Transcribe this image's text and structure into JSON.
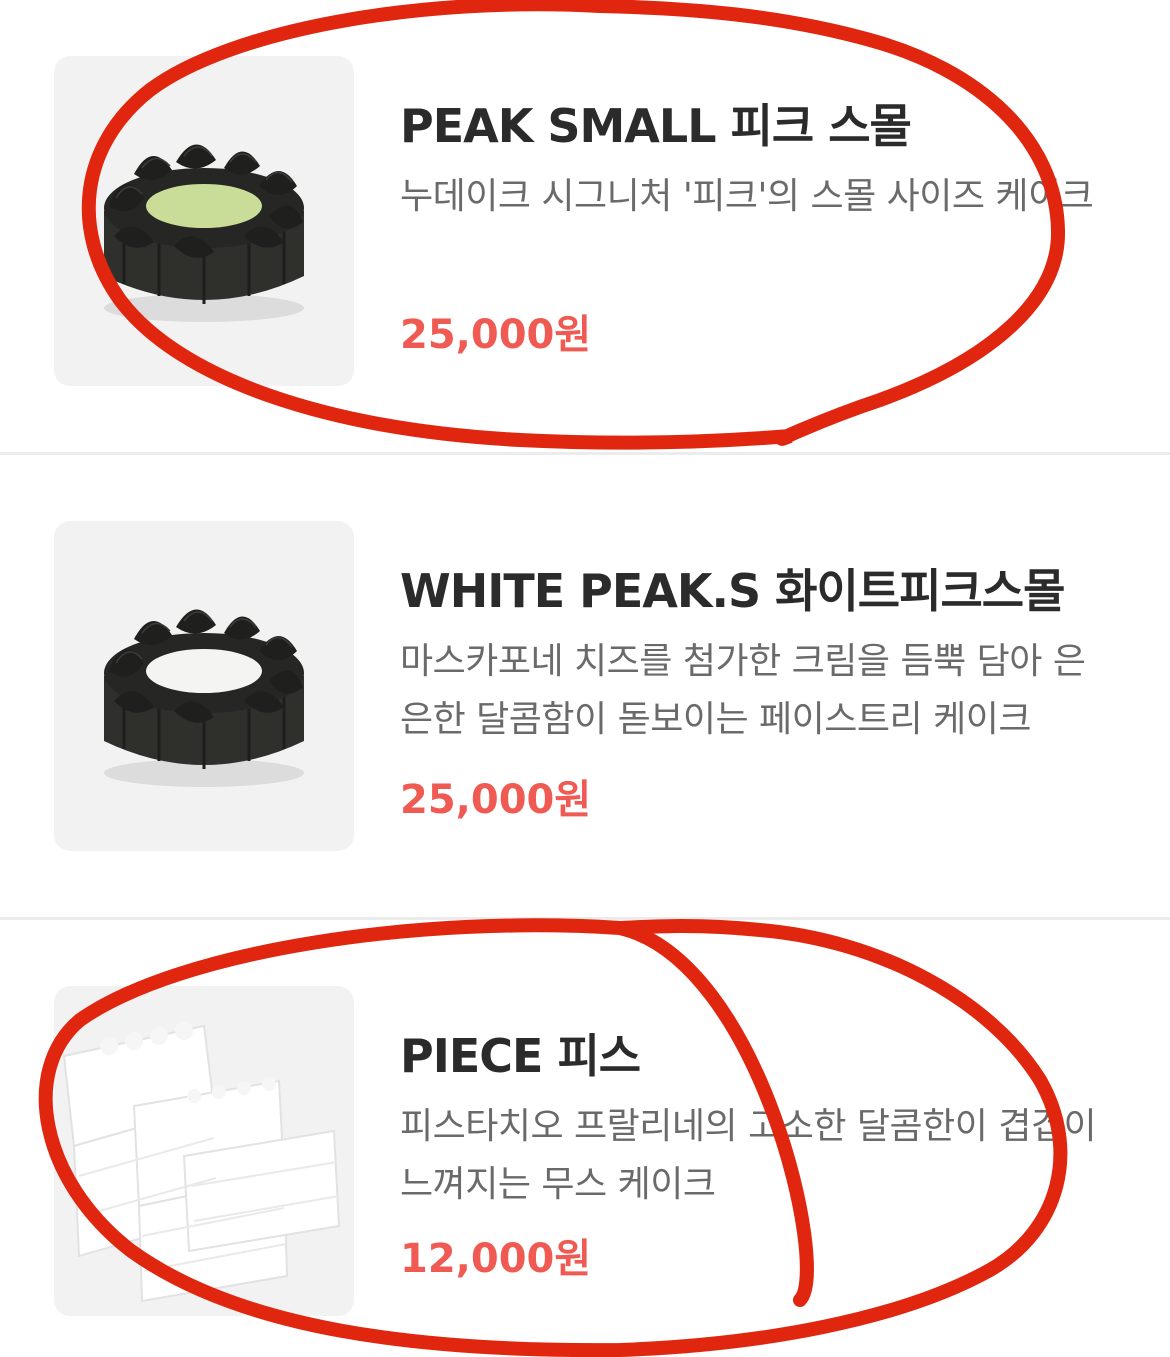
{
  "products": [
    {
      "name": "PEAK SMALL 피크 스몰",
      "description": "누데이크 시그니처 '피크'의 스몰 사이즈 케이크",
      "price": "25,000원",
      "image": "black-peak-cake-green-center"
    },
    {
      "name": "WHITE PEAK.S 화이트피크스몰",
      "description": "마스카포네 치즈를 첨가한 크림을 듬뿍 담아 은은한 달콤함이 돋보이는 페이스트리 케이크",
      "price": "25,000원",
      "image": "black-peak-cake-white-center"
    },
    {
      "name": "PIECE 피스",
      "description": "피스타치오 프랄리네의 고소한 달콤한이 겹겹이 느껴지는 무스 케이크",
      "price": "12,000원",
      "image": "white-layered-cake-slices"
    }
  ],
  "colors": {
    "price": "#ef5a53",
    "annotation": "#e0260f",
    "thumb_bg": "#f2f2f2"
  }
}
